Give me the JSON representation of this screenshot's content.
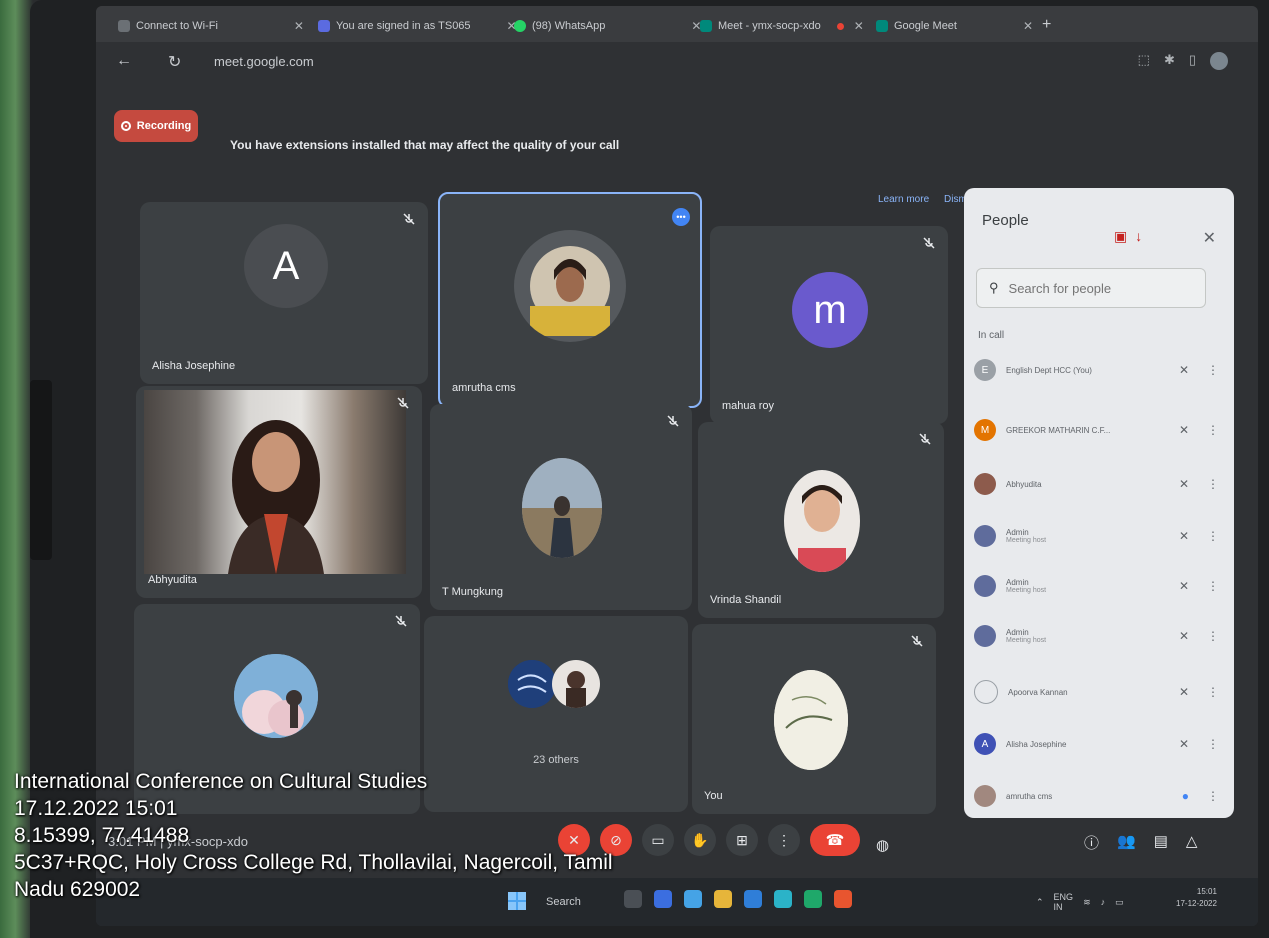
{
  "browser": {
    "tabs": [
      {
        "label": "Connect to Wi-Fi"
      },
      {
        "label": "You are signed in as TS065"
      },
      {
        "label": "(98) WhatsApp"
      },
      {
        "label": "Meet - ymx-socp-xdo"
      },
      {
        "label": "Google Meet"
      }
    ],
    "url": "meet.google.com"
  },
  "banner": {
    "recording_label": "Recording",
    "warning": "You have extensions installed that may affect the quality of your call",
    "learn_more": "Learn more",
    "dismiss": "Dismiss"
  },
  "tiles": [
    {
      "name": "Alisha Josephine",
      "initial": "A"
    },
    {
      "name": "amrutha cms"
    },
    {
      "name": "mahua roy",
      "initial": "m"
    },
    {
      "name": "Abhyudita"
    },
    {
      "name": "T Mungkung"
    },
    {
      "name": "Vrinda Shandil"
    },
    {
      "name": ""
    },
    {
      "name": "23 others"
    },
    {
      "name": "You"
    }
  ],
  "people": {
    "title": "People",
    "search_placeholder": "Search for people",
    "section": "In call",
    "list": [
      {
        "name": "English Dept HCC (You)",
        "initial": "E",
        "color": "#9aa0a6"
      },
      {
        "name": "GREEKOR MATHARIN C.F...",
        "initial": "M",
        "color": "#e37400"
      },
      {
        "name": "Abhyudita",
        "initial": "",
        "color": "#8d5b4c"
      },
      {
        "name": "Admin",
        "role": "Meeting host",
        "initial": "",
        "color": "#5f6c9c"
      },
      {
        "name": "Admin",
        "role": "Meeting host",
        "initial": "",
        "color": "#5f6c9c"
      },
      {
        "name": "Admin",
        "role": "Meeting host",
        "initial": "",
        "color": "#5f6c9c"
      },
      {
        "name": "Apoorva Kannan",
        "initial": "",
        "color": "#e8eaed"
      },
      {
        "name": "Alisha Josephine",
        "initial": "A",
        "color": "#3f51b5"
      },
      {
        "name": "amrutha cms",
        "initial": "",
        "color": "#a1887f"
      }
    ]
  },
  "meeting": {
    "time": "3:01 PM",
    "code": "ymx-socp-xdo"
  },
  "taskbar": {
    "search": "Search",
    "lang": "ENG",
    "region": "IN",
    "clock_time": "15:01",
    "clock_date": "17-12-2022"
  },
  "stamp": {
    "line1": "International Conference on Cultural Studies",
    "line2": "17.12.2022 15:01",
    "line3": "8.15399, 77.41488",
    "line4": "5C37+RQC, Holy Cross College Rd, Thollavilai, Nagercoil, Tamil",
    "line5": "Nadu 629002"
  }
}
